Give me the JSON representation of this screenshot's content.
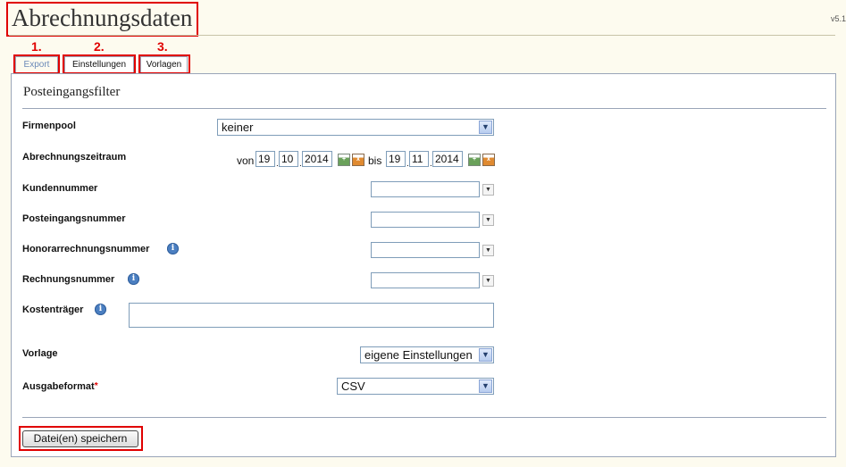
{
  "page": {
    "title": "Abrechnungsdaten",
    "version": "v5.1"
  },
  "markers": [
    "1.",
    "2.",
    "3."
  ],
  "tabs": [
    {
      "label": "Export",
      "active": true
    },
    {
      "label": "Einstellungen",
      "active": false
    },
    {
      "label": "Vorlagen",
      "active": false
    }
  ],
  "filter": {
    "title": "Posteingangsfilter",
    "firmenpool": {
      "label": "Firmenpool",
      "value": "keiner"
    },
    "zeitraum": {
      "label": "Abrechnungszeitraum",
      "von_label": "von",
      "bis_label": "bis",
      "from": {
        "day": "19",
        "month": "10",
        "year": "2014"
      },
      "to": {
        "day": "19",
        "month": "11",
        "year": "2014"
      }
    },
    "kundennummer": {
      "label": "Kundennummer",
      "value": ""
    },
    "posteingangsnummer": {
      "label": "Posteingangsnummer",
      "value": ""
    },
    "honorarrechnungsnummer": {
      "label": "Honorarrechnungsnummer",
      "value": ""
    },
    "rechnungsnummer": {
      "label": "Rechnungsnummer",
      "value": ""
    },
    "kostentraeger": {
      "label": "Kostenträger",
      "value": ""
    },
    "vorlage": {
      "label": "Vorlage",
      "value": "eigene Einstellungen"
    },
    "ausgabeformat": {
      "label": "Ausgabeformat",
      "required_mark": "*",
      "value": "CSV"
    }
  },
  "actions": {
    "save_label": "Datei(en) speichern"
  },
  "colors": {
    "accent": "#e00000",
    "border": "#9aa5b8",
    "tab_active": "#6b8ab8",
    "background": "#fdfbef"
  }
}
